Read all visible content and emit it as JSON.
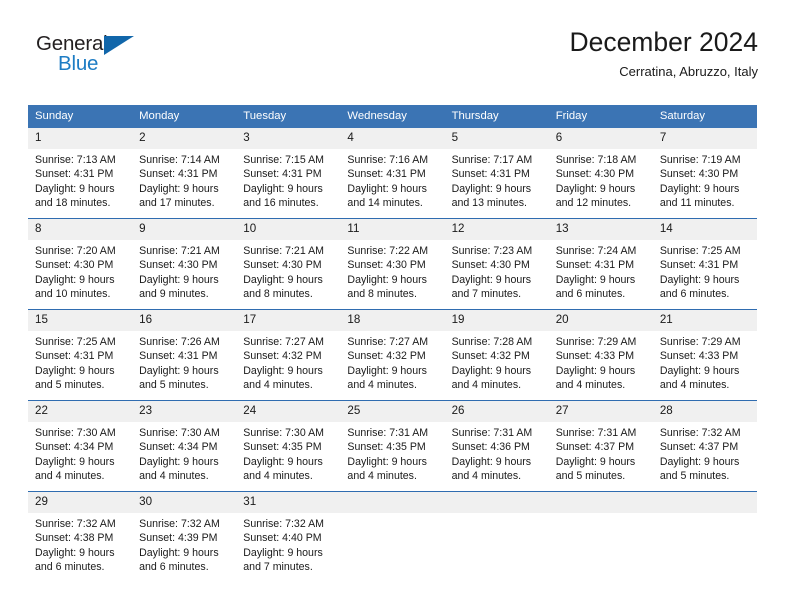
{
  "brand": {
    "name_part1": "General",
    "name_part2": "Blue",
    "triangle_color": "#1166AA",
    "blue_color": "#1D7CC4"
  },
  "header": {
    "title": "December 2024",
    "subtitle": "Cerratina, Abruzzo, Italy"
  },
  "theme": {
    "header_bg": "#3B74B4",
    "header_text": "#FFFFFF",
    "daynum_bg": "#F0F0F0",
    "row_divider": "#2F6CB0",
    "text": "#1A1A1A"
  },
  "weekdays": [
    "Sunday",
    "Monday",
    "Tuesday",
    "Wednesday",
    "Thursday",
    "Friday",
    "Saturday"
  ],
  "weeks": [
    {
      "days": [
        {
          "num": "1",
          "l1": "Sunrise: 7:13 AM",
          "l2": "Sunset: 4:31 PM",
          "l3": "Daylight: 9 hours",
          "l4": "and 18 minutes."
        },
        {
          "num": "2",
          "l1": "Sunrise: 7:14 AM",
          "l2": "Sunset: 4:31 PM",
          "l3": "Daylight: 9 hours",
          "l4": "and 17 minutes."
        },
        {
          "num": "3",
          "l1": "Sunrise: 7:15 AM",
          "l2": "Sunset: 4:31 PM",
          "l3": "Daylight: 9 hours",
          "l4": "and 16 minutes."
        },
        {
          "num": "4",
          "l1": "Sunrise: 7:16 AM",
          "l2": "Sunset: 4:31 PM",
          "l3": "Daylight: 9 hours",
          "l4": "and 14 minutes."
        },
        {
          "num": "5",
          "l1": "Sunrise: 7:17 AM",
          "l2": "Sunset: 4:31 PM",
          "l3": "Daylight: 9 hours",
          "l4": "and 13 minutes."
        },
        {
          "num": "6",
          "l1": "Sunrise: 7:18 AM",
          "l2": "Sunset: 4:30 PM",
          "l3": "Daylight: 9 hours",
          "l4": "and 12 minutes."
        },
        {
          "num": "7",
          "l1": "Sunrise: 7:19 AM",
          "l2": "Sunset: 4:30 PM",
          "l3": "Daylight: 9 hours",
          "l4": "and 11 minutes."
        }
      ]
    },
    {
      "days": [
        {
          "num": "8",
          "l1": "Sunrise: 7:20 AM",
          "l2": "Sunset: 4:30 PM",
          "l3": "Daylight: 9 hours",
          "l4": "and 10 minutes."
        },
        {
          "num": "9",
          "l1": "Sunrise: 7:21 AM",
          "l2": "Sunset: 4:30 PM",
          "l3": "Daylight: 9 hours",
          "l4": "and 9 minutes."
        },
        {
          "num": "10",
          "l1": "Sunrise: 7:21 AM",
          "l2": "Sunset: 4:30 PM",
          "l3": "Daylight: 9 hours",
          "l4": "and 8 minutes."
        },
        {
          "num": "11",
          "l1": "Sunrise: 7:22 AM",
          "l2": "Sunset: 4:30 PM",
          "l3": "Daylight: 9 hours",
          "l4": "and 8 minutes."
        },
        {
          "num": "12",
          "l1": "Sunrise: 7:23 AM",
          "l2": "Sunset: 4:30 PM",
          "l3": "Daylight: 9 hours",
          "l4": "and 7 minutes."
        },
        {
          "num": "13",
          "l1": "Sunrise: 7:24 AM",
          "l2": "Sunset: 4:31 PM",
          "l3": "Daylight: 9 hours",
          "l4": "and 6 minutes."
        },
        {
          "num": "14",
          "l1": "Sunrise: 7:25 AM",
          "l2": "Sunset: 4:31 PM",
          "l3": "Daylight: 9 hours",
          "l4": "and 6 minutes."
        }
      ]
    },
    {
      "days": [
        {
          "num": "15",
          "l1": "Sunrise: 7:25 AM",
          "l2": "Sunset: 4:31 PM",
          "l3": "Daylight: 9 hours",
          "l4": "and 5 minutes."
        },
        {
          "num": "16",
          "l1": "Sunrise: 7:26 AM",
          "l2": "Sunset: 4:31 PM",
          "l3": "Daylight: 9 hours",
          "l4": "and 5 minutes."
        },
        {
          "num": "17",
          "l1": "Sunrise: 7:27 AM",
          "l2": "Sunset: 4:32 PM",
          "l3": "Daylight: 9 hours",
          "l4": "and 4 minutes."
        },
        {
          "num": "18",
          "l1": "Sunrise: 7:27 AM",
          "l2": "Sunset: 4:32 PM",
          "l3": "Daylight: 9 hours",
          "l4": "and 4 minutes."
        },
        {
          "num": "19",
          "l1": "Sunrise: 7:28 AM",
          "l2": "Sunset: 4:32 PM",
          "l3": "Daylight: 9 hours",
          "l4": "and 4 minutes."
        },
        {
          "num": "20",
          "l1": "Sunrise: 7:29 AM",
          "l2": "Sunset: 4:33 PM",
          "l3": "Daylight: 9 hours",
          "l4": "and 4 minutes."
        },
        {
          "num": "21",
          "l1": "Sunrise: 7:29 AM",
          "l2": "Sunset: 4:33 PM",
          "l3": "Daylight: 9 hours",
          "l4": "and 4 minutes."
        }
      ]
    },
    {
      "days": [
        {
          "num": "22",
          "l1": "Sunrise: 7:30 AM",
          "l2": "Sunset: 4:34 PM",
          "l3": "Daylight: 9 hours",
          "l4": "and 4 minutes."
        },
        {
          "num": "23",
          "l1": "Sunrise: 7:30 AM",
          "l2": "Sunset: 4:34 PM",
          "l3": "Daylight: 9 hours",
          "l4": "and 4 minutes."
        },
        {
          "num": "24",
          "l1": "Sunrise: 7:30 AM",
          "l2": "Sunset: 4:35 PM",
          "l3": "Daylight: 9 hours",
          "l4": "and 4 minutes."
        },
        {
          "num": "25",
          "l1": "Sunrise: 7:31 AM",
          "l2": "Sunset: 4:35 PM",
          "l3": "Daylight: 9 hours",
          "l4": "and 4 minutes."
        },
        {
          "num": "26",
          "l1": "Sunrise: 7:31 AM",
          "l2": "Sunset: 4:36 PM",
          "l3": "Daylight: 9 hours",
          "l4": "and 4 minutes."
        },
        {
          "num": "27",
          "l1": "Sunrise: 7:31 AM",
          "l2": "Sunset: 4:37 PM",
          "l3": "Daylight: 9 hours",
          "l4": "and 5 minutes."
        },
        {
          "num": "28",
          "l1": "Sunrise: 7:32 AM",
          "l2": "Sunset: 4:37 PM",
          "l3": "Daylight: 9 hours",
          "l4": "and 5 minutes."
        }
      ]
    },
    {
      "days": [
        {
          "num": "29",
          "l1": "Sunrise: 7:32 AM",
          "l2": "Sunset: 4:38 PM",
          "l3": "Daylight: 9 hours",
          "l4": "and 6 minutes."
        },
        {
          "num": "30",
          "l1": "Sunrise: 7:32 AM",
          "l2": "Sunset: 4:39 PM",
          "l3": "Daylight: 9 hours",
          "l4": "and 6 minutes."
        },
        {
          "num": "31",
          "l1": "Sunrise: 7:32 AM",
          "l2": "Sunset: 4:40 PM",
          "l3": "Daylight: 9 hours",
          "l4": "and 7 minutes."
        },
        {
          "num": "",
          "l1": "",
          "l2": "",
          "l3": "",
          "l4": ""
        },
        {
          "num": "",
          "l1": "",
          "l2": "",
          "l3": "",
          "l4": ""
        },
        {
          "num": "",
          "l1": "",
          "l2": "",
          "l3": "",
          "l4": ""
        },
        {
          "num": "",
          "l1": "",
          "l2": "",
          "l3": "",
          "l4": ""
        }
      ]
    }
  ]
}
